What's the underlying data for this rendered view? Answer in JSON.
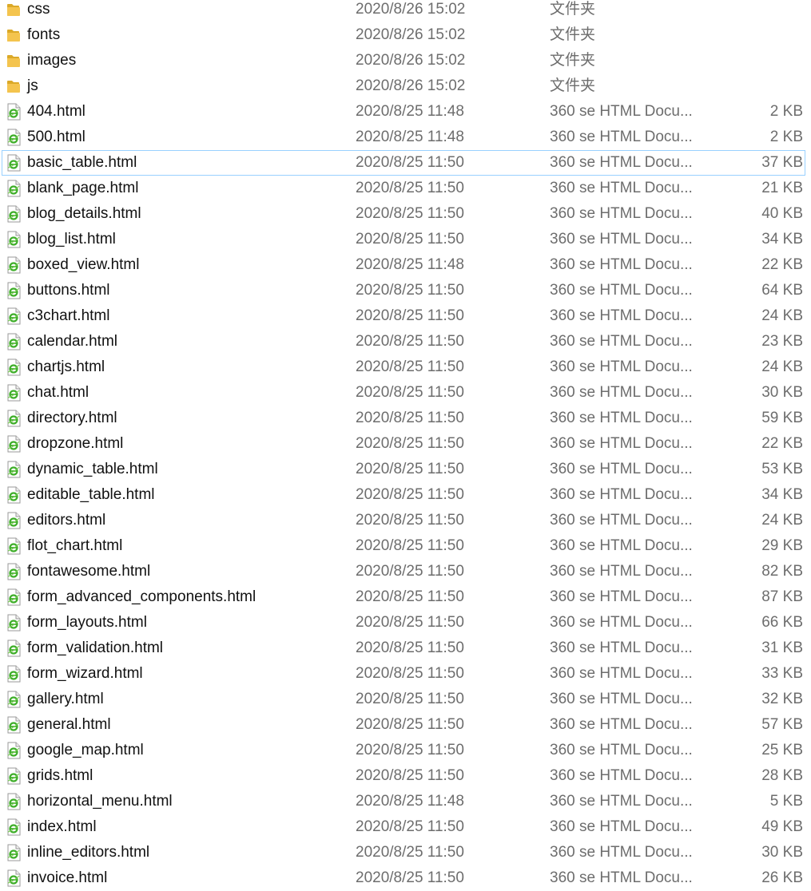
{
  "files": [
    {
      "name": "css",
      "date": "2020/8/26 15:02",
      "type": "文件夹",
      "size": "",
      "icon": "folder-icon"
    },
    {
      "name": "fonts",
      "date": "2020/8/26 15:02",
      "type": "文件夹",
      "size": "",
      "icon": "folder-icon"
    },
    {
      "name": "images",
      "date": "2020/8/26 15:02",
      "type": "文件夹",
      "size": "",
      "icon": "folder-icon"
    },
    {
      "name": "js",
      "date": "2020/8/26 15:02",
      "type": "文件夹",
      "size": "",
      "icon": "folder-icon"
    },
    {
      "name": "404.html",
      "date": "2020/8/25 11:48",
      "type": "360 se HTML Docu...",
      "size": "2 KB",
      "icon": "html-file-icon"
    },
    {
      "name": "500.html",
      "date": "2020/8/25 11:48",
      "type": "360 se HTML Docu...",
      "size": "2 KB",
      "icon": "html-file-icon"
    },
    {
      "name": "basic_table.html",
      "date": "2020/8/25 11:50",
      "type": "360 se HTML Docu...",
      "size": "37 KB",
      "icon": "html-file-icon",
      "hover": true
    },
    {
      "name": "blank_page.html",
      "date": "2020/8/25 11:50",
      "type": "360 se HTML Docu...",
      "size": "21 KB",
      "icon": "html-file-icon"
    },
    {
      "name": "blog_details.html",
      "date": "2020/8/25 11:50",
      "type": "360 se HTML Docu...",
      "size": "40 KB",
      "icon": "html-file-icon"
    },
    {
      "name": "blog_list.html",
      "date": "2020/8/25 11:50",
      "type": "360 se HTML Docu...",
      "size": "34 KB",
      "icon": "html-file-icon"
    },
    {
      "name": "boxed_view.html",
      "date": "2020/8/25 11:48",
      "type": "360 se HTML Docu...",
      "size": "22 KB",
      "icon": "html-file-icon"
    },
    {
      "name": "buttons.html",
      "date": "2020/8/25 11:50",
      "type": "360 se HTML Docu...",
      "size": "64 KB",
      "icon": "html-file-icon"
    },
    {
      "name": "c3chart.html",
      "date": "2020/8/25 11:50",
      "type": "360 se HTML Docu...",
      "size": "24 KB",
      "icon": "html-file-icon"
    },
    {
      "name": "calendar.html",
      "date": "2020/8/25 11:50",
      "type": "360 se HTML Docu...",
      "size": "23 KB",
      "icon": "html-file-icon"
    },
    {
      "name": "chartjs.html",
      "date": "2020/8/25 11:50",
      "type": "360 se HTML Docu...",
      "size": "24 KB",
      "icon": "html-file-icon"
    },
    {
      "name": "chat.html",
      "date": "2020/8/25 11:50",
      "type": "360 se HTML Docu...",
      "size": "30 KB",
      "icon": "html-file-icon"
    },
    {
      "name": "directory.html",
      "date": "2020/8/25 11:50",
      "type": "360 se HTML Docu...",
      "size": "59 KB",
      "icon": "html-file-icon"
    },
    {
      "name": "dropzone.html",
      "date": "2020/8/25 11:50",
      "type": "360 se HTML Docu...",
      "size": "22 KB",
      "icon": "html-file-icon"
    },
    {
      "name": "dynamic_table.html",
      "date": "2020/8/25 11:50",
      "type": "360 se HTML Docu...",
      "size": "53 KB",
      "icon": "html-file-icon"
    },
    {
      "name": "editable_table.html",
      "date": "2020/8/25 11:50",
      "type": "360 se HTML Docu...",
      "size": "34 KB",
      "icon": "html-file-icon"
    },
    {
      "name": "editors.html",
      "date": "2020/8/25 11:50",
      "type": "360 se HTML Docu...",
      "size": "24 KB",
      "icon": "html-file-icon"
    },
    {
      "name": "flot_chart.html",
      "date": "2020/8/25 11:50",
      "type": "360 se HTML Docu...",
      "size": "29 KB",
      "icon": "html-file-icon"
    },
    {
      "name": "fontawesome.html",
      "date": "2020/8/25 11:50",
      "type": "360 se HTML Docu...",
      "size": "82 KB",
      "icon": "html-file-icon"
    },
    {
      "name": "form_advanced_components.html",
      "date": "2020/8/25 11:50",
      "type": "360 se HTML Docu...",
      "size": "87 KB",
      "icon": "html-file-icon"
    },
    {
      "name": "form_layouts.html",
      "date": "2020/8/25 11:50",
      "type": "360 se HTML Docu...",
      "size": "66 KB",
      "icon": "html-file-icon"
    },
    {
      "name": "form_validation.html",
      "date": "2020/8/25 11:50",
      "type": "360 se HTML Docu...",
      "size": "31 KB",
      "icon": "html-file-icon"
    },
    {
      "name": "form_wizard.html",
      "date": "2020/8/25 11:50",
      "type": "360 se HTML Docu...",
      "size": "33 KB",
      "icon": "html-file-icon"
    },
    {
      "name": "gallery.html",
      "date": "2020/8/25 11:50",
      "type": "360 se HTML Docu...",
      "size": "32 KB",
      "icon": "html-file-icon"
    },
    {
      "name": "general.html",
      "date": "2020/8/25 11:50",
      "type": "360 se HTML Docu...",
      "size": "57 KB",
      "icon": "html-file-icon"
    },
    {
      "name": "google_map.html",
      "date": "2020/8/25 11:50",
      "type": "360 se HTML Docu...",
      "size": "25 KB",
      "icon": "html-file-icon"
    },
    {
      "name": "grids.html",
      "date": "2020/8/25 11:50",
      "type": "360 se HTML Docu...",
      "size": "28 KB",
      "icon": "html-file-icon"
    },
    {
      "name": "horizontal_menu.html",
      "date": "2020/8/25 11:48",
      "type": "360 se HTML Docu...",
      "size": "5 KB",
      "icon": "html-file-icon"
    },
    {
      "name": "index.html",
      "date": "2020/8/25 11:50",
      "type": "360 se HTML Docu...",
      "size": "49 KB",
      "icon": "html-file-icon"
    },
    {
      "name": "inline_editors.html",
      "date": "2020/8/25 11:50",
      "type": "360 se HTML Docu...",
      "size": "30 KB",
      "icon": "html-file-icon"
    },
    {
      "name": "invoice.html",
      "date": "2020/8/25 11:50",
      "type": "360 se HTML Docu...",
      "size": "26 KB",
      "icon": "html-file-icon"
    }
  ],
  "colors": {
    "folder": "#f4c44e",
    "folder_dark": "#dba928",
    "html_icon_green": "#3fae2a",
    "hover_border": "#99d1ff",
    "secondary_text": "#6d6d6d"
  }
}
